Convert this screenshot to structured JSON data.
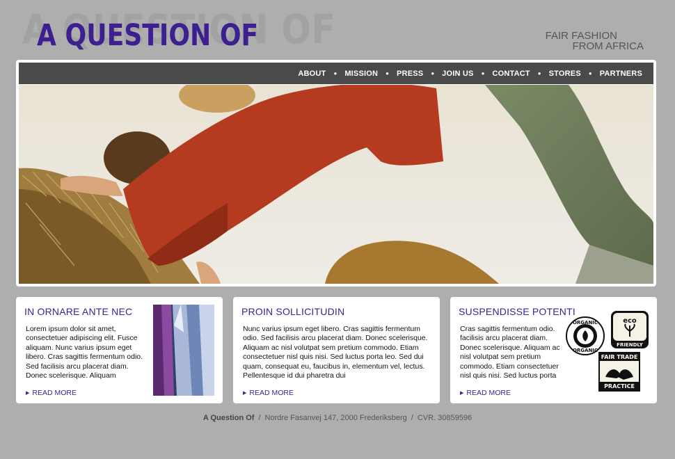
{
  "header": {
    "logo_ghost": "A QUESTION OF",
    "logo": "A QUESTION OF",
    "tagline_line1": "FAIR FASHION",
    "tagline_line2": "FROM AFRICA"
  },
  "nav": [
    "ABOUT",
    "MISSION",
    "PRESS",
    "JOIN US",
    "CONTACT",
    "STORES",
    "PARTNERS"
  ],
  "cards": [
    {
      "title": "IN ORNARE ANTE NEC",
      "body": "Lorem ipsum dolor sit amet, consectetuer adipiscing elit. Fusce aliquam. Nunc varius ipsum eget libero. Cras sagittis fermentum odio. Sed facilisis arcu placerat diam. Donec scelerisque. Aliquam",
      "read_more": "READ MORE"
    },
    {
      "title": "PROIN SOLLICITUDIN",
      "body": "Nunc varius ipsum eget libero. Cras sagittis fermentum odio. Sed facilisis arcu placerat diam. Donec scelerisque. Aliquam ac nisl volutpat sem pretium commodo. Etiam consectetuer nisl quis nisi. Sed luctus porta leo. Sed dui quam, consequat eu, faucibus in, elementum vel, lectus. Pellentesque id dui pharetra dui",
      "read_more": "READ MORE"
    },
    {
      "title": "SUSPENDISSE POTENTI",
      "body": "Cras sagittis fermentum odio. facilisis arcu placerat diam. Donec scelerisque. Aliquam ac nisl volutpat sem pretium commodo. Etiam consectetuer nisl quis nisi. Sed luctus porta",
      "read_more": "READ MORE",
      "badges": {
        "organic_outer": "ORGANIC",
        "organic_inner": "ORGANIC",
        "eco": "eco",
        "friendly": "FRIENDLY",
        "fair_trade_top": "FAIR TRADE",
        "fair_trade_bottom": "PRACTICE"
      }
    }
  ],
  "footer": {
    "company": "A Question Of",
    "address": "Nordre Fasanvej 147, 2000 Frederiksberg",
    "cvr": "CVR. 30859596",
    "separator": "/"
  },
  "colors": {
    "brand_purple": "#3d1f8f",
    "nav_bg": "#4a4a4a",
    "page_bg": "#aeaeae"
  }
}
